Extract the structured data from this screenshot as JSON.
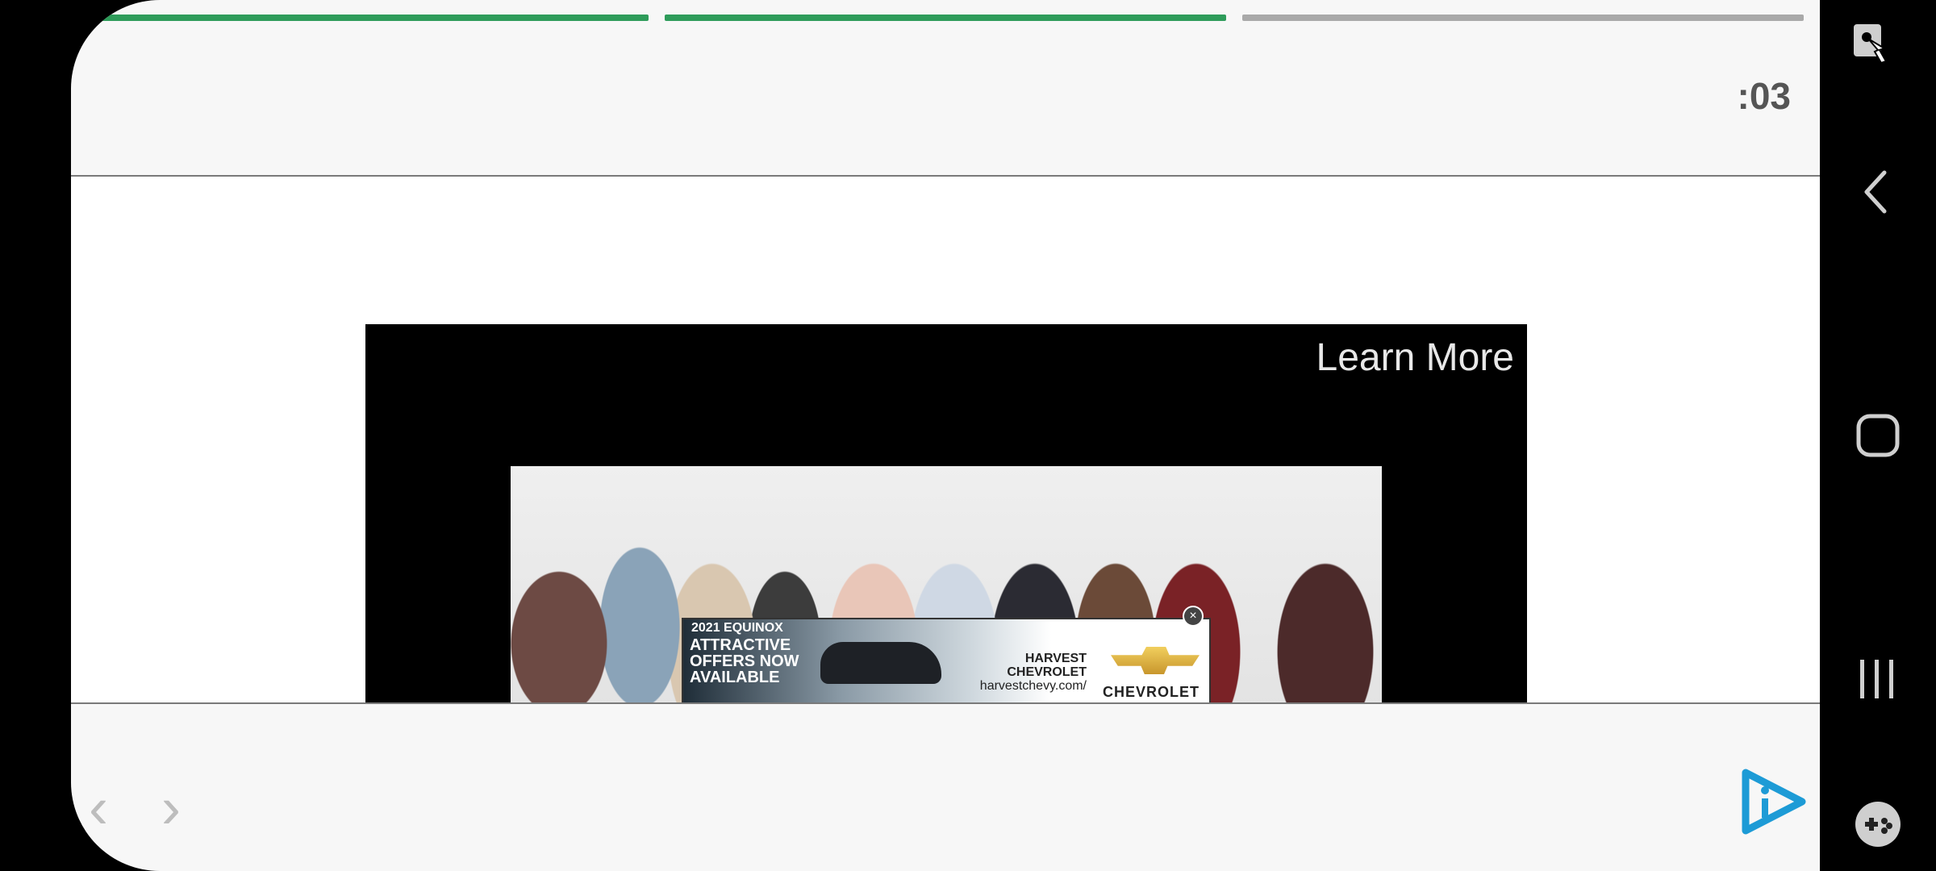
{
  "header": {
    "timer": ":03"
  },
  "progress": [
    {
      "state": "complete",
      "color": "#2e9c5a"
    },
    {
      "state": "complete",
      "color": "#2e9c5a"
    },
    {
      "state": "pending",
      "color": "#a9a9a9"
    }
  ],
  "video": {
    "learn_more_label": "Learn More",
    "ad": {
      "model": "2021 EQUINOX",
      "offer": "ATTRACTIVE OFFERS NOW AVAILABLE",
      "dealer_line1": "HARVEST",
      "dealer_line2": "CHEVROLET",
      "url": "harvestchevy.com/",
      "brand": "CHEVROLET",
      "close_glyph": "×"
    }
  },
  "footer": {
    "prev_glyph": "‹",
    "next_glyph": "›",
    "logo_icon": "play-info-logo-icon",
    "accent": "#1d9bd6"
  },
  "system_nav": {
    "icons": [
      "accessibility-touch-icon",
      "back-icon",
      "home-icon",
      "recents-icon",
      "game-launcher-icon"
    ]
  }
}
